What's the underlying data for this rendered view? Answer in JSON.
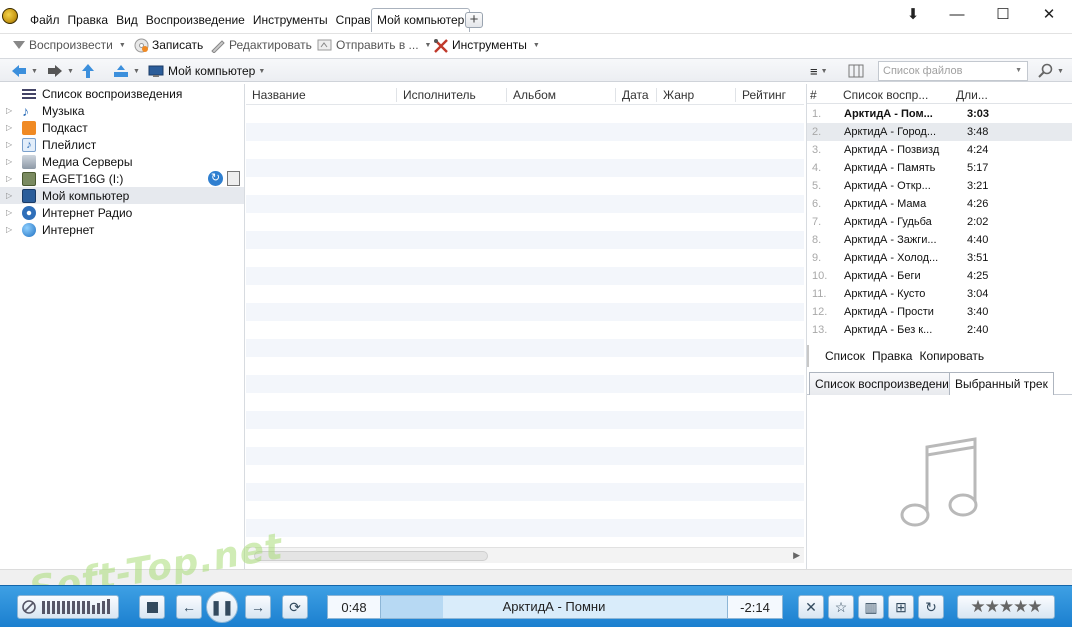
{
  "menu": [
    {
      "label": "Файл"
    },
    {
      "label": "Правка"
    },
    {
      "label": "Вид"
    },
    {
      "label": "Воспроизведение"
    },
    {
      "label": "Инструменты"
    },
    {
      "label": "Справка"
    }
  ],
  "tab": {
    "label": "Мой компьютер",
    "add_label": "+"
  },
  "window": {
    "minimize": "—",
    "maximize": "☐",
    "close": "✕",
    "pin": "⬇"
  },
  "toolbar": {
    "play": "Воспроизвести",
    "burn": "Записать",
    "edit": "Редактировать",
    "send": "Отправить в ...",
    "tools": "Инструменты"
  },
  "nav": {
    "location": "Мой компьютер",
    "search_placeholder": "Список файлов"
  },
  "tree": [
    {
      "label": "Список воспроизведения"
    },
    {
      "label": "Музыка"
    },
    {
      "label": "Подкаст"
    },
    {
      "label": "Плейлист"
    },
    {
      "label": "Медиа Серверы"
    },
    {
      "label": "EAGET16G (I:)"
    },
    {
      "label": "Мой компьютер"
    },
    {
      "label": "Интернет Радио"
    },
    {
      "label": "Интернет"
    }
  ],
  "columns": [
    "Название",
    "Исполнитель",
    "Альбом",
    "Дата",
    "Жанр",
    "Рейтинг"
  ],
  "playlist": {
    "headers": {
      "num": "#",
      "title": "Список воспр...",
      "duration": "Дли..."
    },
    "tracks": [
      {
        "num": "1.",
        "title": "АрктидА - Пом...",
        "duration": "3:03"
      },
      {
        "num": "2.",
        "title": "АрктидА - Город...",
        "duration": "3:48"
      },
      {
        "num": "3.",
        "title": "АрктидА - Позвизд",
        "duration": "4:24"
      },
      {
        "num": "4.",
        "title": "АрктидА - Память",
        "duration": "5:17"
      },
      {
        "num": "5.",
        "title": "АрктидА - Откр...",
        "duration": "3:21"
      },
      {
        "num": "6.",
        "title": "АрктидА - Мама",
        "duration": "4:26"
      },
      {
        "num": "7.",
        "title": "АрктидА - Гудьба",
        "duration": "2:02"
      },
      {
        "num": "8.",
        "title": "АрктидА - Зажги...",
        "duration": "4:40"
      },
      {
        "num": "9.",
        "title": "АрктидА - Холод...",
        "duration": "3:51"
      },
      {
        "num": "10.",
        "title": "АрктидА - Беги",
        "duration": "4:25"
      },
      {
        "num": "11.",
        "title": "АрктидА - Кусто",
        "duration": "3:04"
      },
      {
        "num": "12.",
        "title": "АрктидА - Прости",
        "duration": "3:40"
      },
      {
        "num": "13.",
        "title": "АрктидА - Без к...",
        "duration": "2:40"
      }
    ],
    "links": {
      "list": "Список",
      "edit": "Правка",
      "copy": "Копировать"
    },
    "tabs": {
      "playlist": "Список воспроизведения",
      "selected": "Выбранный трек"
    }
  },
  "player": {
    "elapsed": "0:48",
    "track": "АрктидА - Помни",
    "remaining": "-2:14",
    "progress_fraction": 0.18,
    "rating": "★★★★★"
  },
  "watermark": "Soft-Top.net",
  "colors": {
    "player_bar": "#2a8fd9",
    "selection": "#e6e9ee"
  }
}
